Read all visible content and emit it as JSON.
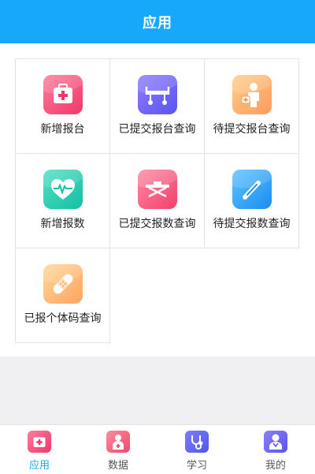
{
  "header": {
    "title": "应用"
  },
  "apps": [
    {
      "label": "新增报台",
      "icon": "medical-kit-icon"
    },
    {
      "label": "已提交报台查询",
      "icon": "gurney-icon"
    },
    {
      "label": "待提交报台查询",
      "icon": "doctor-icon"
    },
    {
      "label": "新增报数",
      "icon": "heartbeat-icon"
    },
    {
      "label": "已提交报数查询",
      "icon": "stretcher-icon"
    },
    {
      "label": "待提交报数查询",
      "icon": "thermometer-icon"
    },
    {
      "label": "已报个体码查询",
      "icon": "bandage-icon"
    }
  ],
  "tabbar": {
    "tabs": [
      {
        "label": "应用",
        "icon": "medical-kit-icon",
        "active": true
      },
      {
        "label": "数据",
        "icon": "nurse-icon",
        "active": false
      },
      {
        "label": "学习",
        "icon": "stethoscope-icon",
        "active": false
      },
      {
        "label": "我的",
        "icon": "doctor-icon",
        "active": false
      }
    ]
  },
  "colors": {
    "header": "#17a8fb",
    "active_tab": "#17a8fb",
    "grid_border": "#e4e4e4",
    "page_background": "#f0f0f3"
  }
}
